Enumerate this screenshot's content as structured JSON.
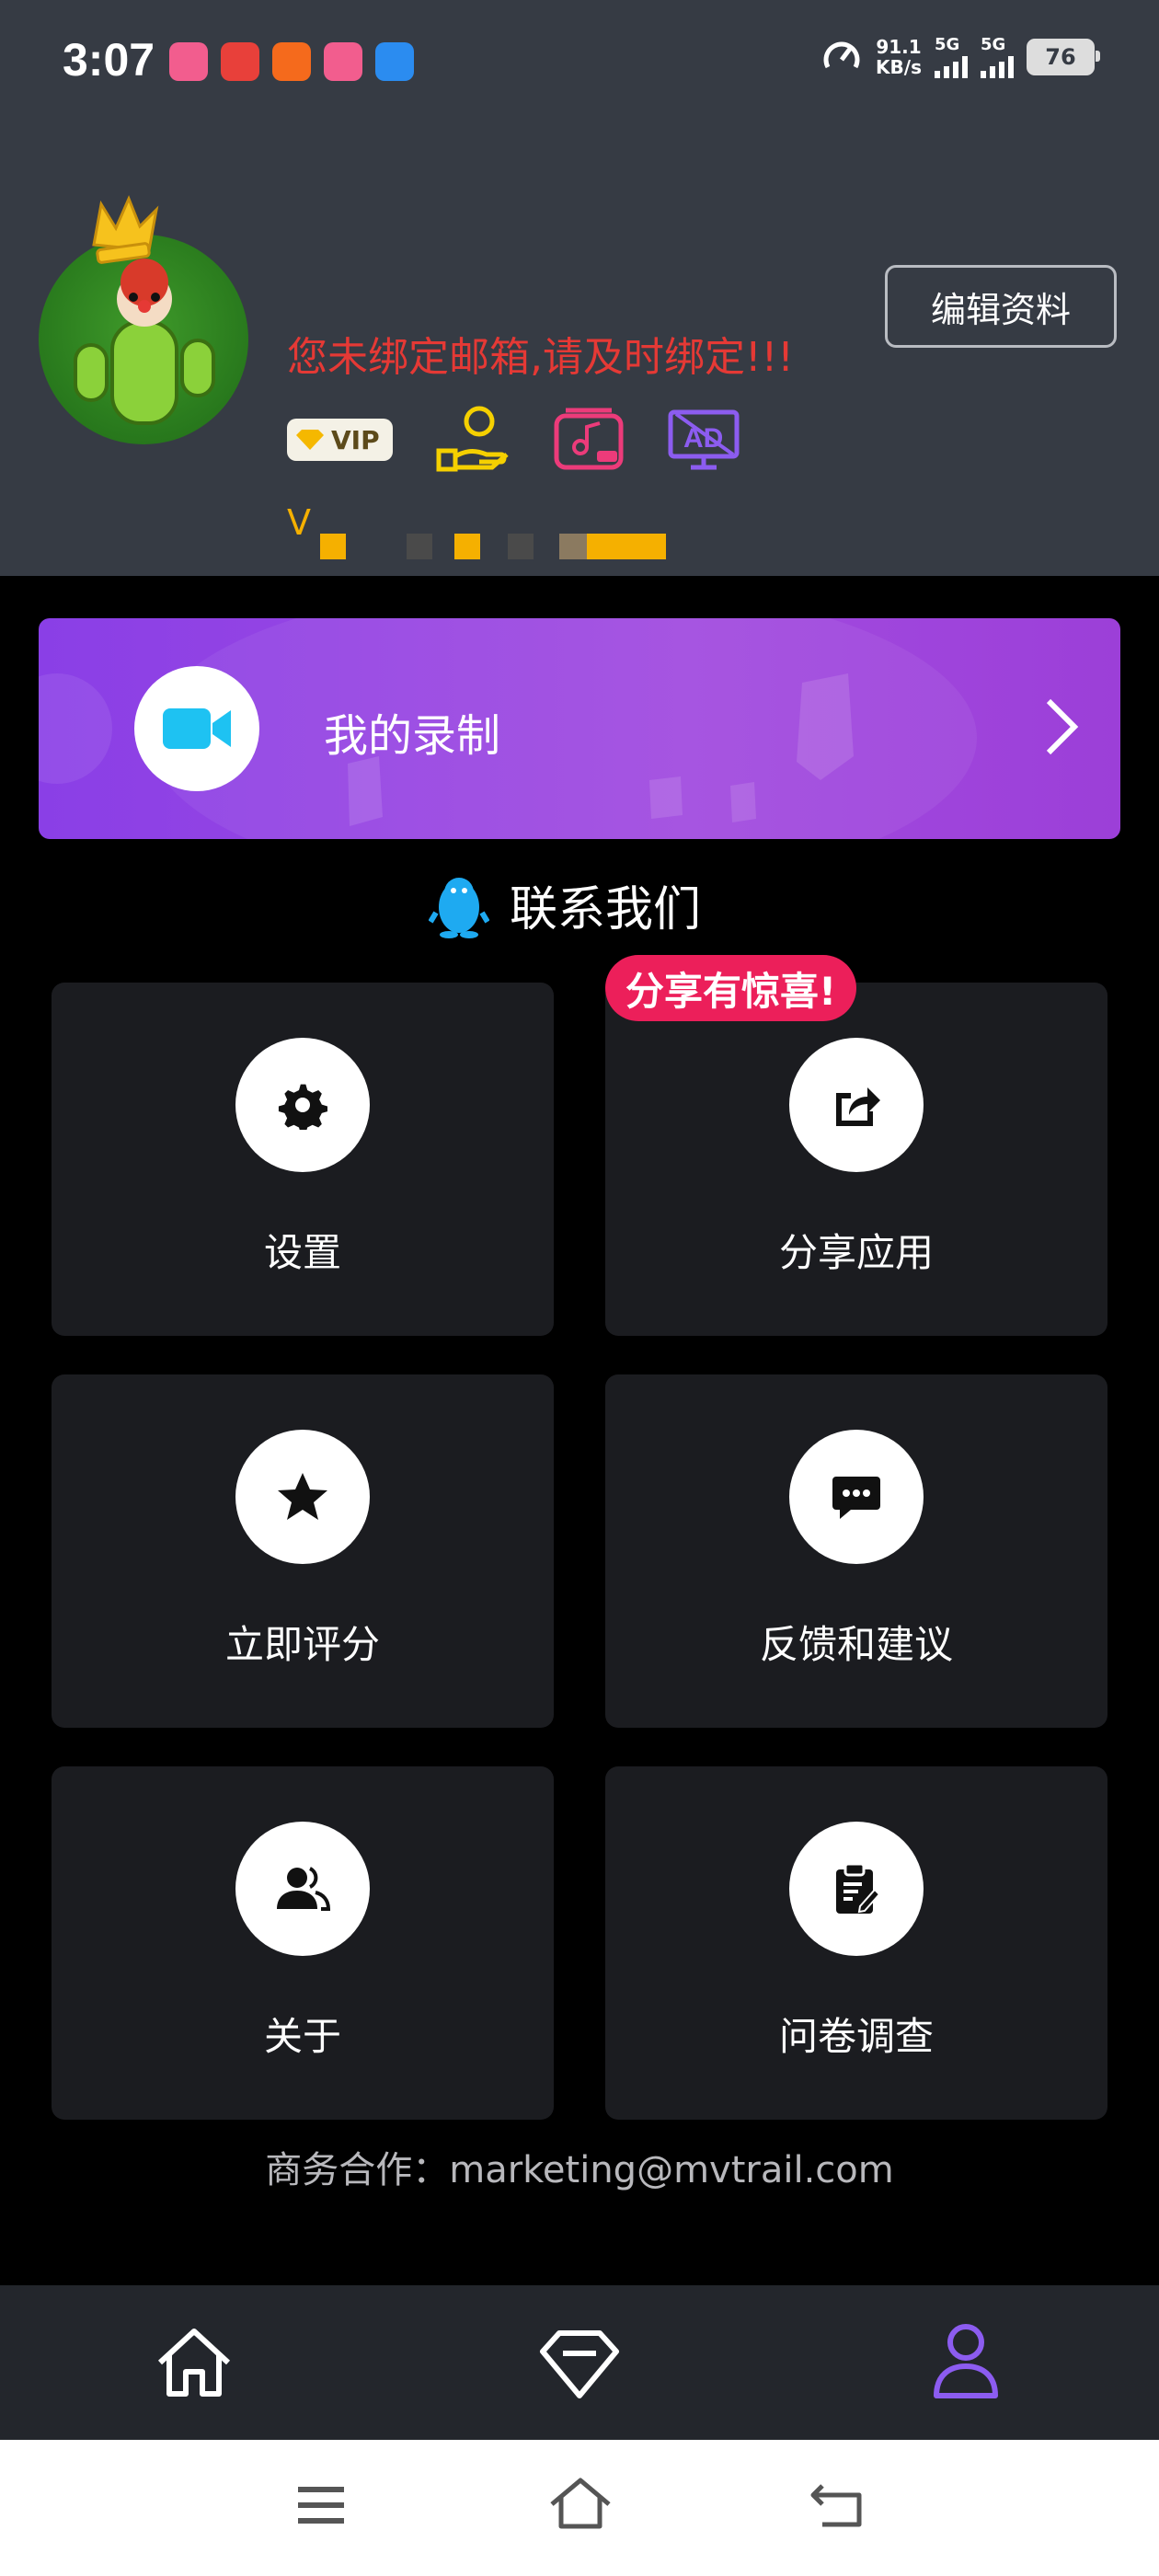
{
  "status_bar": {
    "time": "3:07",
    "net_speed_value": "91.1",
    "net_speed_unit": "KB/s",
    "signal1_label": "5G",
    "signal2_label": "5G",
    "battery": "76"
  },
  "profile": {
    "warning": "您未绑定邮箱,请及时绑定!!!",
    "edit_button": "编辑资料",
    "vip_badge": "VIP",
    "level_prefix": "V"
  },
  "record": {
    "title": "我的录制"
  },
  "contact": {
    "label": "联系我们"
  },
  "share_badge": "分享有惊喜!",
  "menu": {
    "settings": "设置",
    "share": "分享应用",
    "rate": "立即评分",
    "feedback": "反馈和建议",
    "about": "关于",
    "survey": "问卷调查"
  },
  "business": "商务合作：marketing@mvtrail.com",
  "colors": {
    "header_bg": "#363b44",
    "accent_purple": "#9c3fd8",
    "warning_red": "#e53935",
    "badge_pink": "#ec1f5a",
    "nav_active": "#8c5cf0"
  }
}
